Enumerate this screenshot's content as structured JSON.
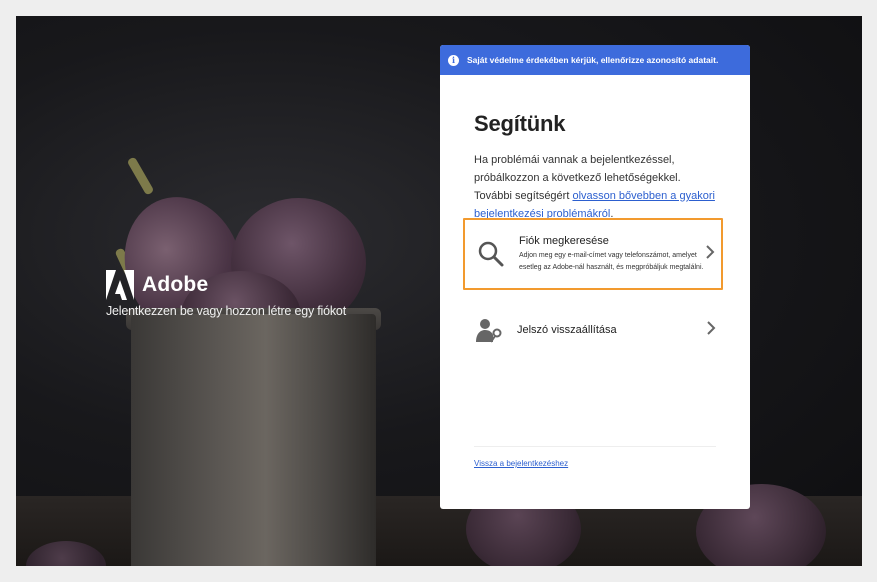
{
  "brand": {
    "name": "Adobe",
    "tagline": "Jelentkezzen be vagy hozzon létre egy fiókot"
  },
  "banner": {
    "text": "Saját védelme érdekében kérjük, ellenőrizze azonosító adatait."
  },
  "panel": {
    "title": "Segítünk",
    "description_prefix": "Ha problémái vannak a bejelentkezéssel, próbálkozzon a következő lehetőségekkel. További segítségért ",
    "description_link": "olvasson bővebben a gyakori bejelentkezési problémákról",
    "description_suffix": ".",
    "options": [
      {
        "icon": "search-icon",
        "title": "Fiók megkeresése",
        "subtitle": "Adjon meg egy e-mail-címet vagy telefonszámot, amelyet esetleg az Adobe-nál használt, és megpróbáljuk megtalálni.",
        "highlight_color": "#f29a2e"
      },
      {
        "icon": "user-key-icon",
        "title": "Jelszó visszaállítása"
      }
    ],
    "back_link": "Vissza a bejelentkezéshez"
  },
  "colors": {
    "banner": "#3d6bdc",
    "link": "#2c5fcf",
    "highlight": "#f29a2e"
  }
}
